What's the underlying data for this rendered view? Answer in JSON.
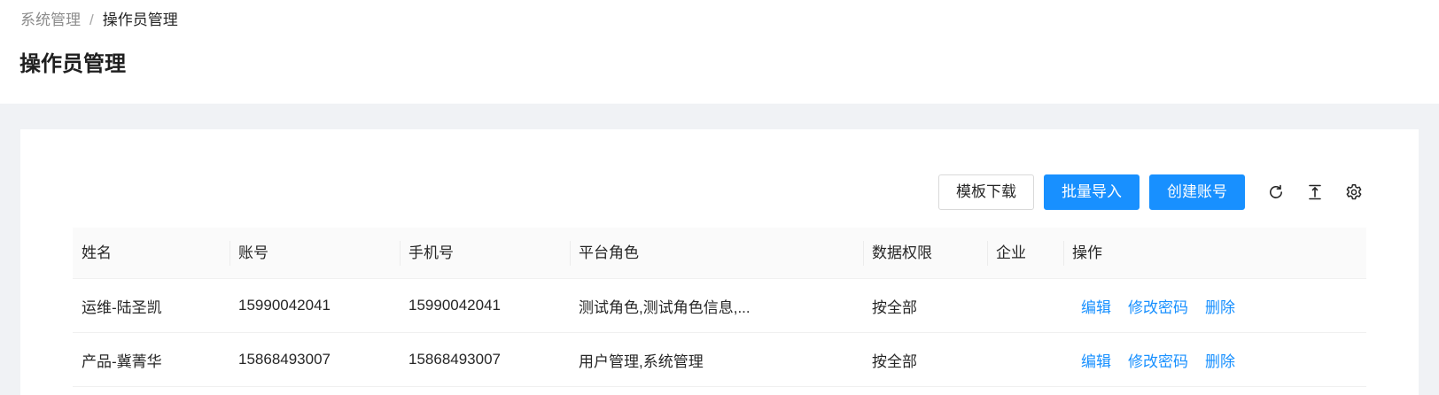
{
  "breadcrumb": {
    "parent": "系统管理",
    "separator": "/",
    "current": "操作员管理"
  },
  "page": {
    "title": "操作员管理"
  },
  "toolbar": {
    "template_download": "模板下载",
    "batch_import": "批量导入",
    "create_account": "创建账号",
    "icons": [
      "reload-icon",
      "column-height-icon",
      "setting-icon"
    ]
  },
  "table": {
    "columns": [
      "姓名",
      "账号",
      "手机号",
      "平台角色",
      "数据权限",
      "企业",
      "操作"
    ],
    "rows": [
      {
        "name": "运维-陆圣凯",
        "account": "15990042041",
        "phone": "15990042041",
        "roles": "测试角色,测试角色信息,...",
        "data_scope": "按全部",
        "company": "",
        "actions": [
          "编辑",
          "修改密码",
          "删除"
        ]
      },
      {
        "name": "产品-冀菁华",
        "account": "15868493007",
        "phone": "15868493007",
        "roles": "用户管理,系统管理",
        "data_scope": "按全部",
        "company": "",
        "actions": [
          "编辑",
          "修改密码",
          "删除"
        ]
      }
    ]
  },
  "colors": {
    "primary": "#1890ff",
    "background": "#f0f2f5"
  }
}
